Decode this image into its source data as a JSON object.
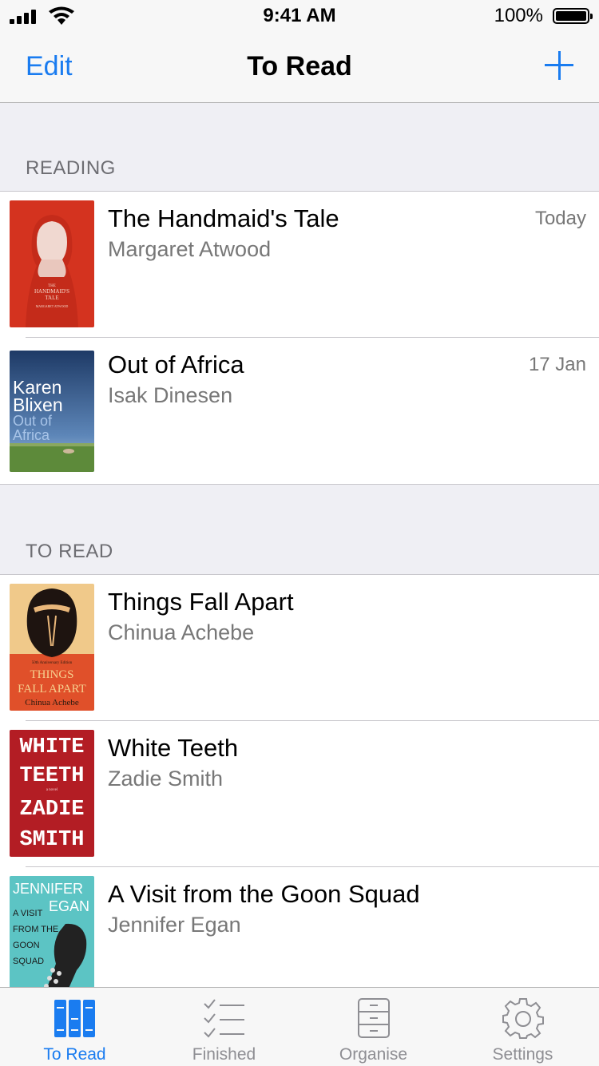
{
  "status": {
    "time": "9:41 AM",
    "battery": "100%"
  },
  "nav": {
    "edit": "Edit",
    "title": "To Read"
  },
  "sections": [
    {
      "header": "READING",
      "items": [
        {
          "title": "The Handmaid's Tale",
          "author": "Margaret Atwood",
          "date": "Today"
        },
        {
          "title": "Out of Africa",
          "author": "Isak Dinesen",
          "date": "17 Jan"
        }
      ]
    },
    {
      "header": "TO READ",
      "items": [
        {
          "title": "Things Fall Apart",
          "author": "Chinua Achebe"
        },
        {
          "title": "White Teeth",
          "author": "Zadie Smith"
        },
        {
          "title": "A Visit from the Goon Squad",
          "author": "Jennifer Egan"
        }
      ]
    }
  ],
  "covers": {
    "handmaid": {
      "lines": [
        "THE",
        "HANDMAID'S",
        "TALE",
        "MARGARET ATWOOD"
      ]
    },
    "africa": {
      "lines": [
        "Karen",
        "Blixen",
        "Out of",
        "Africa"
      ]
    },
    "things": {
      "lines": [
        "50th Anniversary Edition",
        "THINGS",
        "FALL APART",
        "Chinua Achebe"
      ]
    },
    "white": {
      "lines": [
        "WHITE",
        "TEETH",
        "a novel",
        "ZADIE",
        "SMITH"
      ]
    },
    "goon": {
      "lines": [
        "JENNIFER",
        "EGAN",
        "A VISIT",
        "FROM THE",
        "GOON",
        "SQUAD"
      ]
    }
  },
  "tabs": [
    {
      "label": "To Read",
      "icon": "books-icon",
      "active": true
    },
    {
      "label": "Finished",
      "icon": "checklist-icon",
      "active": false
    },
    {
      "label": "Organise",
      "icon": "cabinet-icon",
      "active": false
    },
    {
      "label": "Settings",
      "icon": "gear-icon",
      "active": false
    }
  ],
  "colors": {
    "accent": "#1a7cf0",
    "inactive": "#8e8e93"
  }
}
